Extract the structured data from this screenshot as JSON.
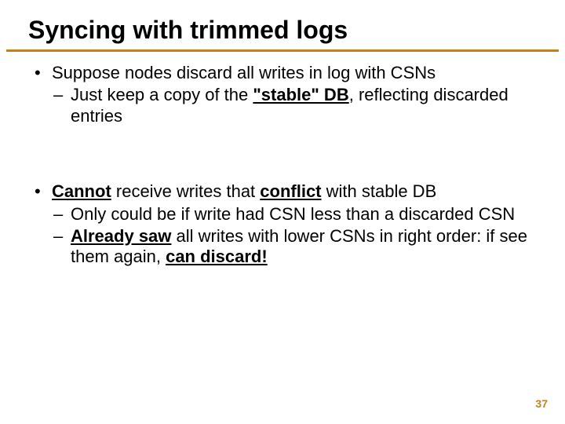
{
  "title": "Syncing with trimmed logs",
  "bullets": [
    {
      "text_pre": "Suppose nodes discard all writes in log with CSNs",
      "subs": [
        {
          "pre": "Just keep a copy of the ",
          "bold_u": "\"stable\" DB",
          "post": ", reflecting discarded entries"
        }
      ]
    },
    {
      "rich": {
        "b1": "Cannot",
        "m1": " receive writes that ",
        "b2": "conflict",
        "m2": " with stable DB"
      },
      "subs": [
        {
          "plain": "Only could be if write had CSN less than a discarded CSN"
        },
        {
          "b1": "Already saw",
          "m1": " all writes with lower CSNs in right order: if see them again, ",
          "b2": "can discard!"
        }
      ]
    }
  ],
  "page": "37"
}
